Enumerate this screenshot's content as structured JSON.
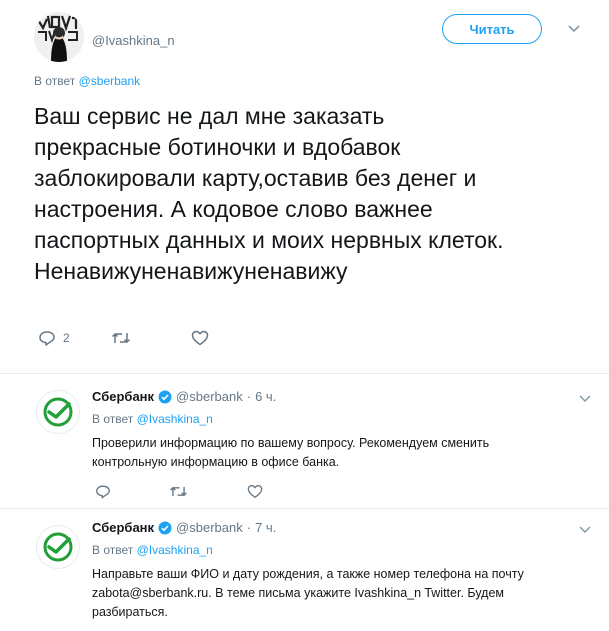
{
  "main_tweet": {
    "handle": "@Ivashkina_n",
    "follow_label": "Читать",
    "reply_to_prefix": "В ответ",
    "reply_to_mention": "@sberbank",
    "text": "Ваш              сервис не дал мне заказать\nпрекрасные ботиночки и вдобавок\nзаблокировали карту,оставив без денег и\nнастроения. А кодовое слово важнее\nпаспортных данных и моих нервных клеток.\nНенавижуненавижуненавижу",
    "reply_count": "2"
  },
  "replies": [
    {
      "name": "Сбербанк",
      "handle": "@sberbank",
      "separator": "·",
      "time": "6 ч.",
      "reply_to_prefix": "В ответ",
      "reply_to_mention": "@Ivashkina_n",
      "text": "Проверили информацию по вашему вопросу. Рекомендуем сменить\nконтрольную информацию в офисе банка."
    },
    {
      "name": "Сбербанк",
      "handle": "@sberbank",
      "separator": "·",
      "time": "7 ч.",
      "reply_to_prefix": "В ответ",
      "reply_to_mention": "@Ivashkina_n",
      "text": "Направьте ваши ФИО и дату рождения, а также номер телефона на почту\nzabota@sberbank.ru. В теме письма укажите Ivashkina_n Twitter. Будем\nразбираться."
    }
  ],
  "colors": {
    "accent": "#1da1f2",
    "secondary_text": "#657786",
    "sberbank_green": "#21a038"
  },
  "icons": {
    "reply": "reply-icon",
    "retweet": "retweet-icon",
    "like": "heart-icon",
    "more": "chevron-down-icon",
    "verified": "verified-badge-icon"
  }
}
